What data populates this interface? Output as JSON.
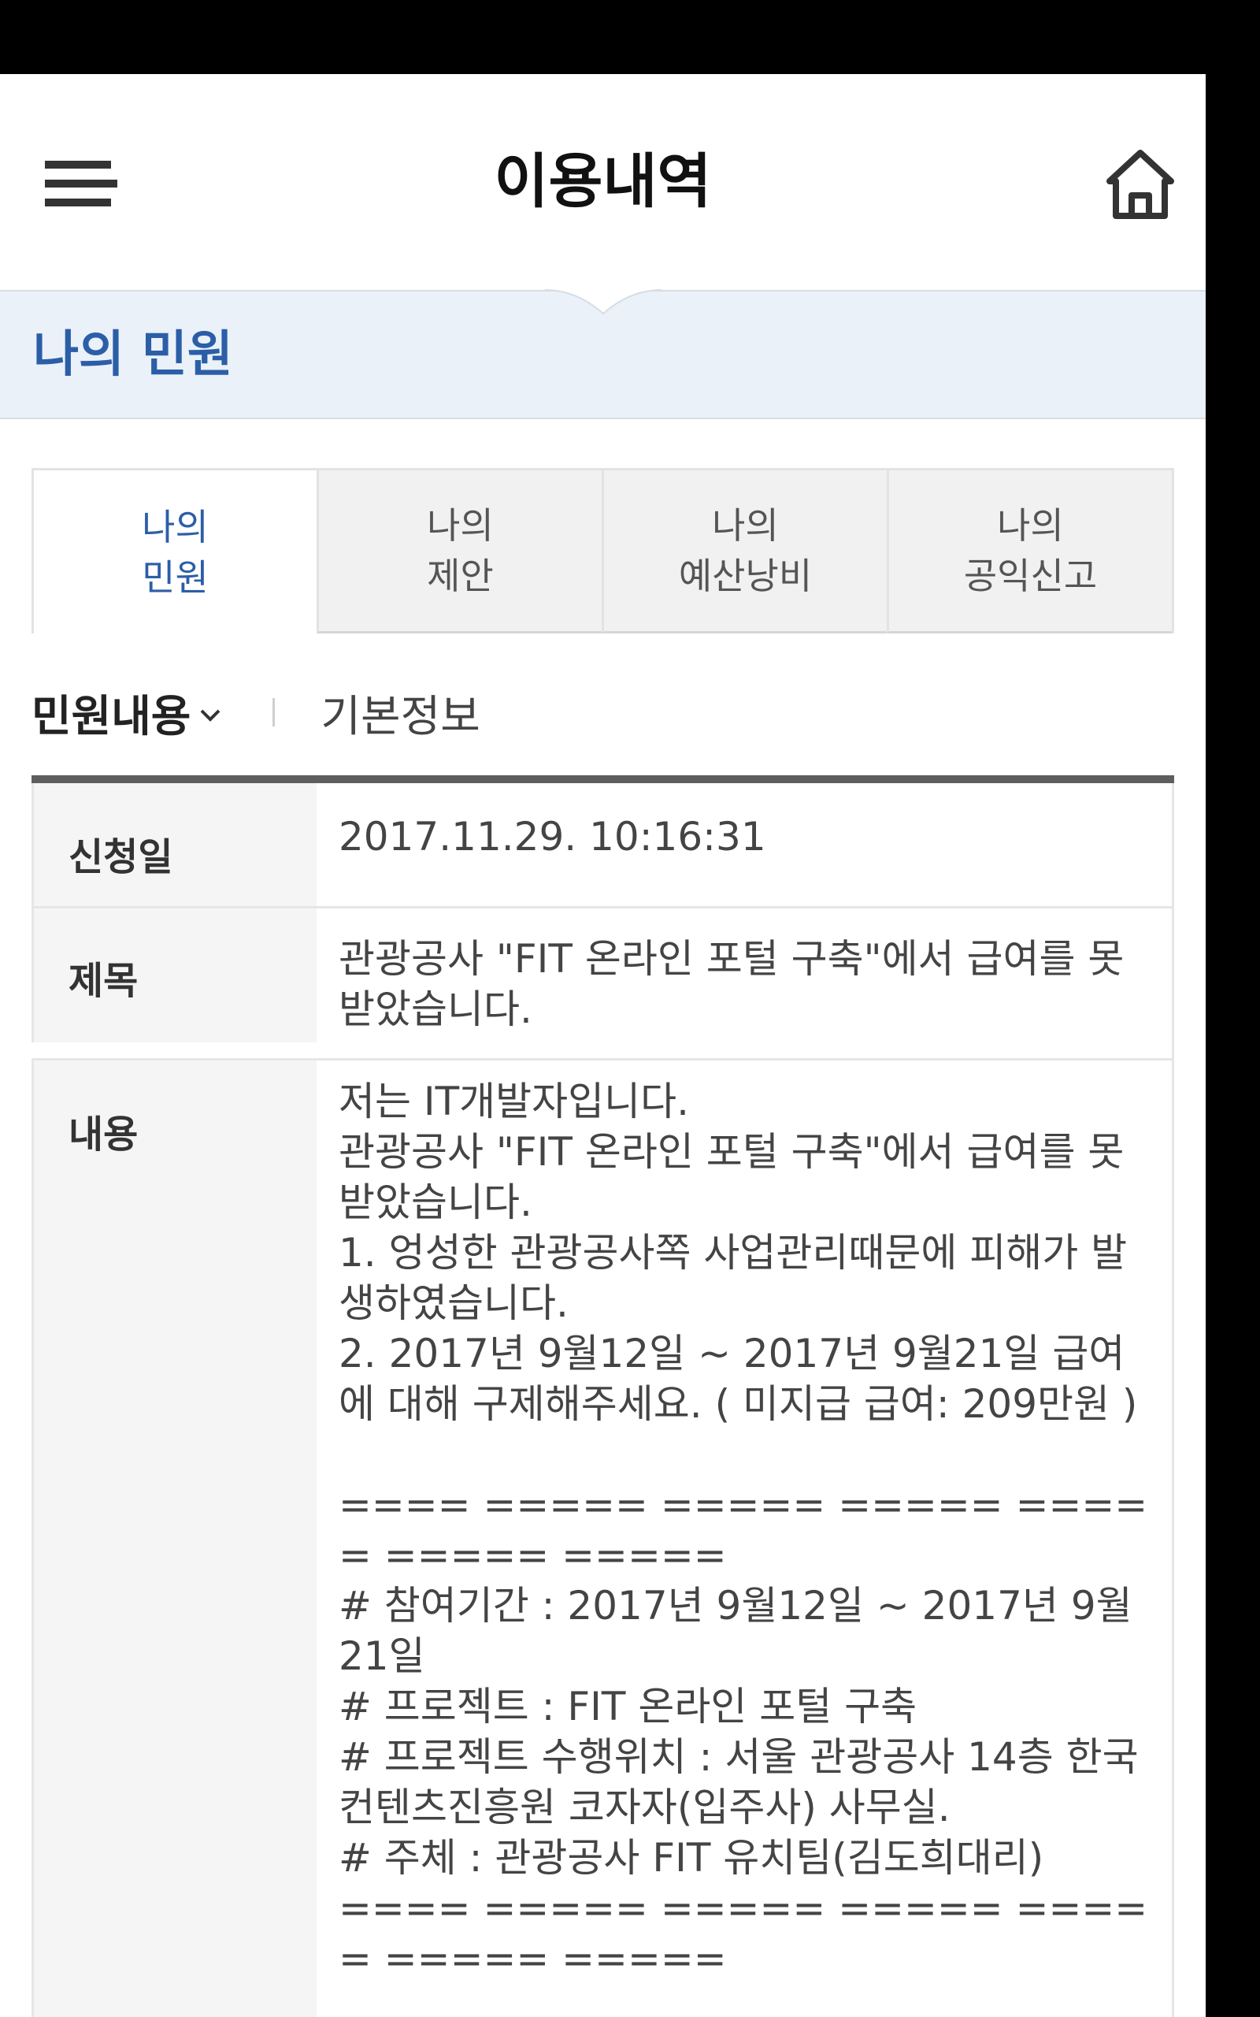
{
  "header": {
    "title": "이용내역"
  },
  "section": {
    "title": "나의 민원"
  },
  "tabs": [
    {
      "label": "나의\n민원",
      "active": true
    },
    {
      "label": "나의\n제안",
      "active": false
    },
    {
      "label": "나의\n예산낭비",
      "active": false
    },
    {
      "label": "나의\n공익신고",
      "active": false
    }
  ],
  "subtabs": {
    "active": "민원내용",
    "other": "기본정보"
  },
  "detail": {
    "date_label": "신청일",
    "date_value": "2017.11.29. 10:16:31",
    "subject_label": "제목",
    "subject_value": "관광공사 \"FIT 온라인 포털 구축\"에서 급여를 못 받았습니다.",
    "content_label": "내용",
    "content_value": "저는 IT개발자입니다.\n관광공사 \"FIT 온라인 포털 구축\"에서 급여를 못 받았습니다.\n1. 엉성한 관광공사쪽 사업관리때문에 피해가 발생하였습니다.\n2. 2017년 9월12일 ~ 2017년 9월21일 급여에 대해 구제해주세요. ( 미지급 급여: 209만원 )\n\n==== ===== ===== ===== ===== ===== =====\n# 참여기간 : 2017년 9월12일 ~ 2017년 9월21일\n# 프로젝트 : FIT 온라인 포털 구축\n# 프로젝트 수행위치 : 서울 관광공사 14층 한국컨텐츠진흥원 코자자(입주사) 사무실.\n# 주체 : 관광공사 FIT 유치팀(김도희대리)\n==== ===== ===== ===== ===== ===== ====="
  },
  "icons": {
    "menu": "hamburger-menu-icon",
    "home": "home-icon",
    "dropdown": "chevron-down-icon"
  },
  "colors": {
    "accent": "#2c5ea8",
    "band": "#eaf1f8",
    "table_border": "#5e5e5e"
  }
}
